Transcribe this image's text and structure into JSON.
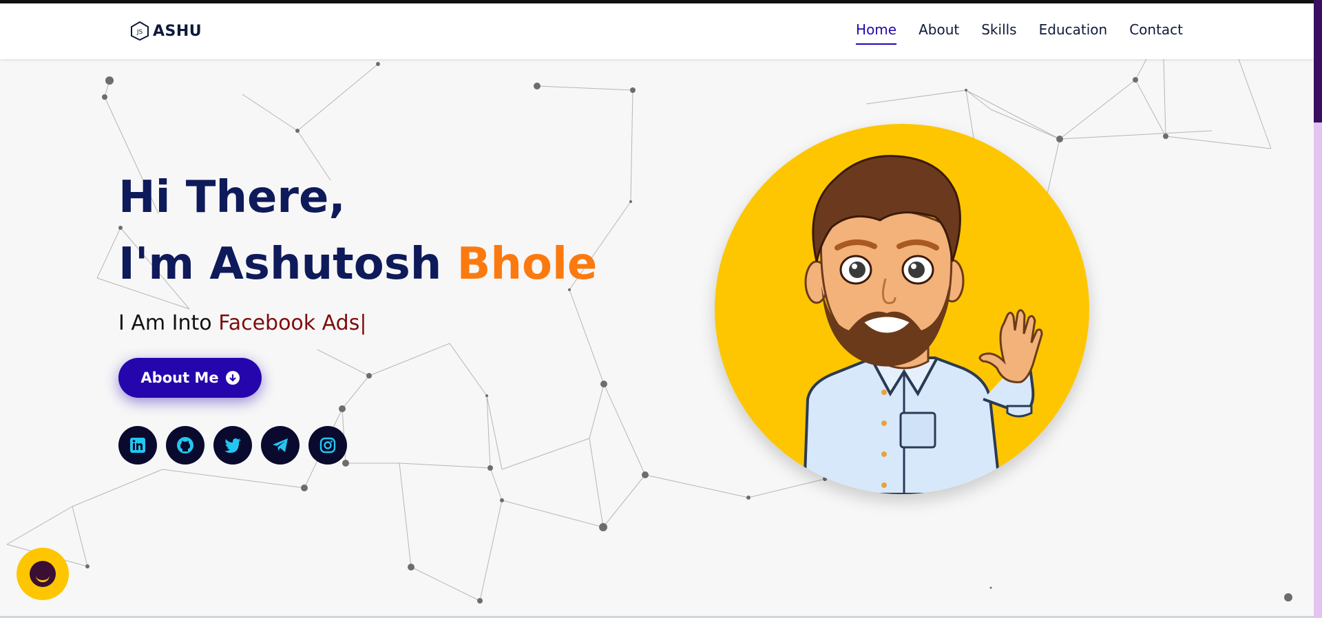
{
  "header": {
    "logo_text": "ASHU",
    "nav": [
      {
        "label": "Home",
        "active": true
      },
      {
        "label": "About",
        "active": false
      },
      {
        "label": "Skills",
        "active": false
      },
      {
        "label": "Education",
        "active": false
      },
      {
        "label": "Contact",
        "active": false
      }
    ]
  },
  "hero": {
    "greeting": "Hi There,",
    "name_prefix": "I'm Ashutosh ",
    "name_surname": "Bhole",
    "into_prefix": "I Am Into ",
    "into_typed": "Facebook Ads|",
    "about_button": "About Me",
    "socials": [
      "linkedin-icon",
      "github-icon",
      "twitter-icon",
      "telegram-icon",
      "instagram-icon"
    ]
  },
  "colors": {
    "primary": "#2506ad",
    "heading": "#0e1a5a",
    "accent": "#fb7a10",
    "typed": "#7d0d0d",
    "avatar_bg": "#fdc600",
    "social_bg": "#0a0a2e",
    "social_icon": "#22c6f0"
  }
}
